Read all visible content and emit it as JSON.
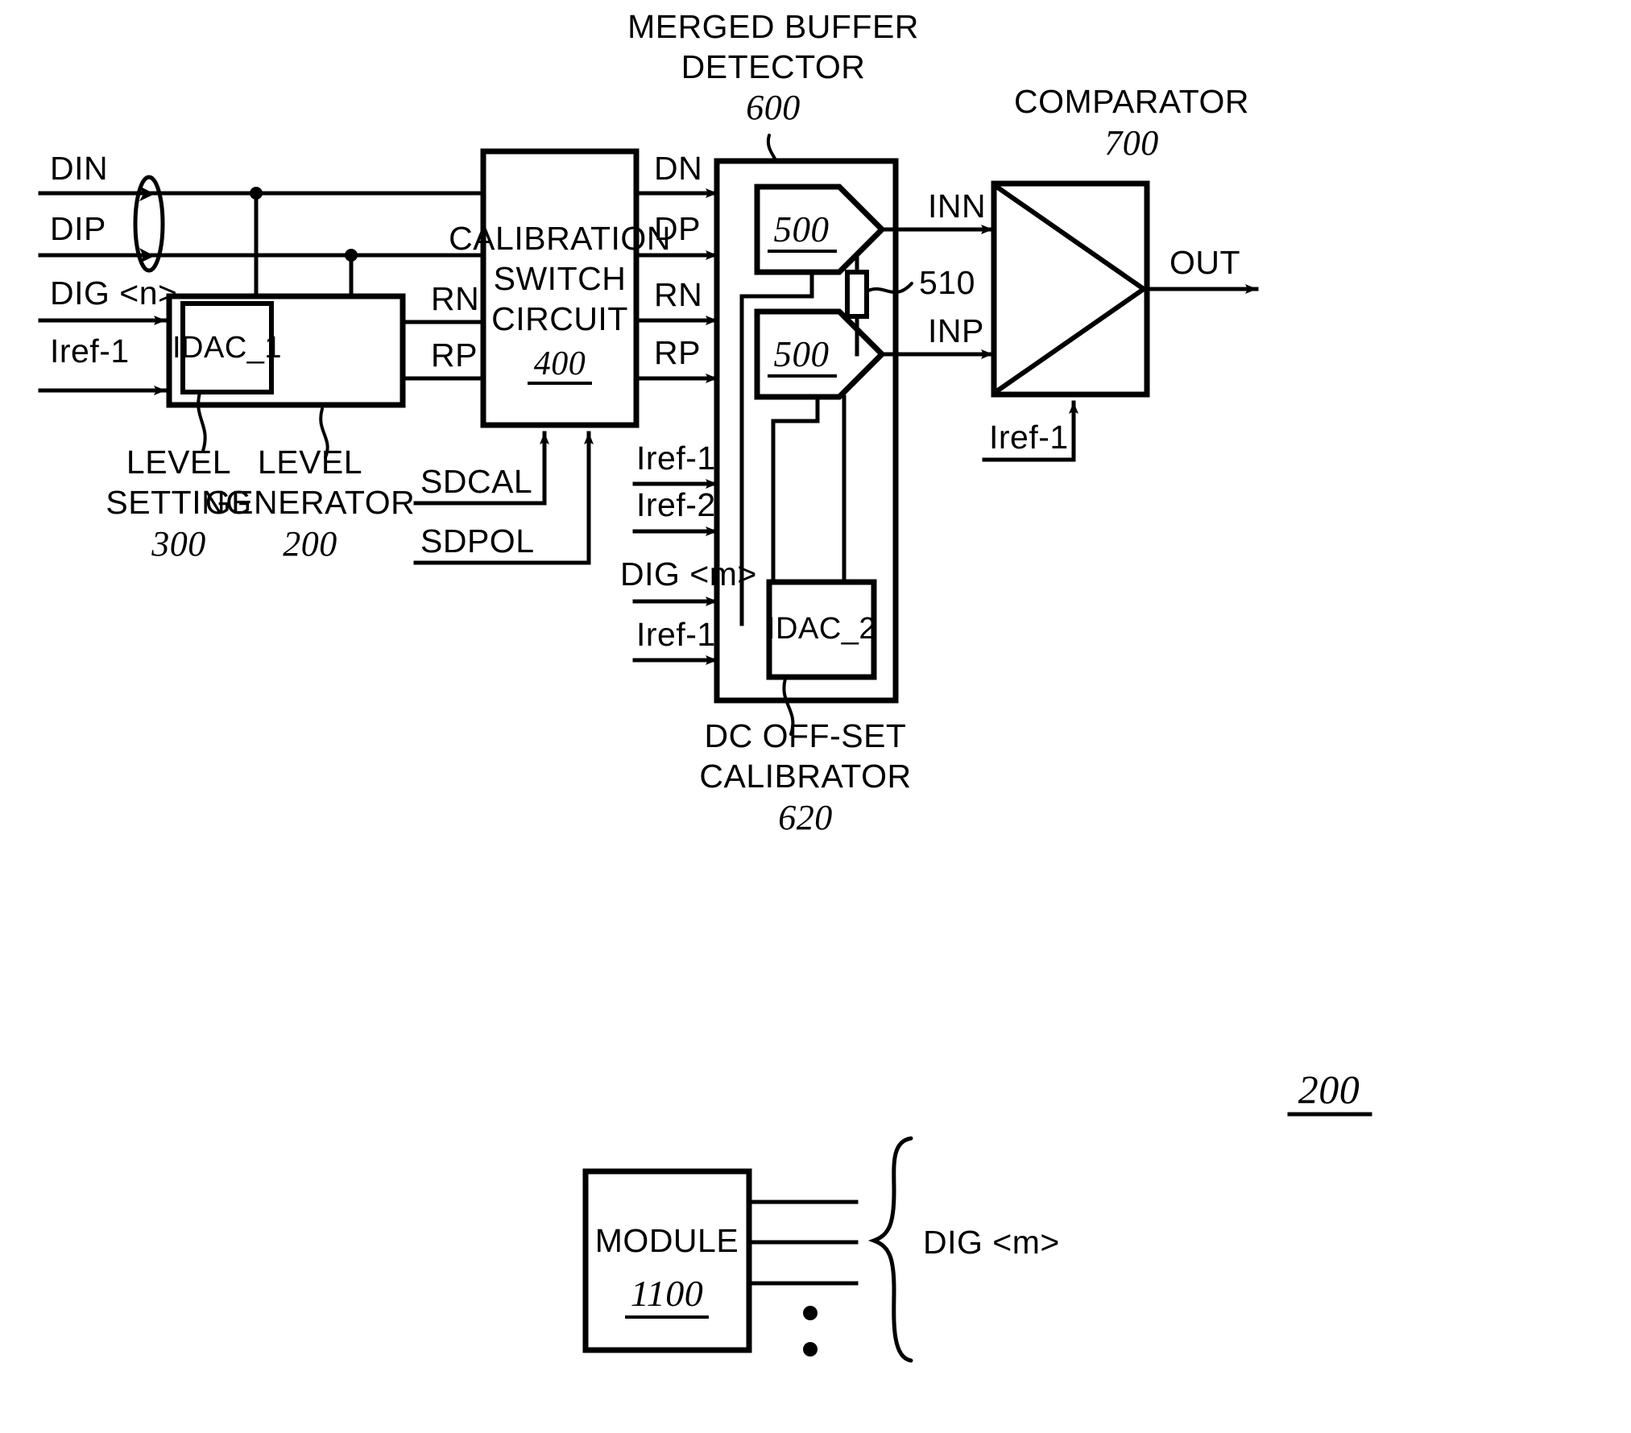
{
  "figure": {
    "figure_number": "200",
    "title_labels": {
      "merged_buffer_detector_l1": "MERGED BUFFER",
      "merged_buffer_detector_l2": "DETECTOR",
      "merged_buffer_detector_num": "600",
      "comparator": "COMPARATOR",
      "comparator_num": "700"
    }
  },
  "inputs": {
    "din": "DIN",
    "dip": "DIP",
    "dig_n": "DIG <n>",
    "iref1_levelsetting": "Iref-1",
    "sdcal": "SDCAL",
    "sdpol": "SDPOL",
    "iref1_detector_a": "Iref-1",
    "iref2_detector": "Iref-2",
    "dig_m_detector": "DIG <m>",
    "iref1_detector_b": "Iref-1",
    "iref1_comparator": "Iref-1"
  },
  "blocks": {
    "idac1": {
      "label": "IDAC_1"
    },
    "level_setting": {
      "line1": "LEVEL",
      "line2": "SETTING",
      "number": "300"
    },
    "level_generator": {
      "line1": "LEVEL",
      "line2": "GENERATOR",
      "number": "200"
    },
    "calibration_switch": {
      "line1": "CALIBRATION",
      "line2": "SWITCH",
      "line3": "CIRCUIT",
      "number": "400"
    },
    "buffer_top": {
      "number": "500"
    },
    "buffer_bottom": {
      "number": "500"
    },
    "resistor": {
      "number": "510"
    },
    "idac2": {
      "label": "IDAC_2"
    },
    "dc_offset_calibrator": {
      "line1": "DC OFF-SET",
      "line2": "CALIBRATOR",
      "number": "620"
    },
    "module": {
      "label": "MODULE",
      "number": "1100"
    }
  },
  "signals": {
    "dn": "DN",
    "dp": "DP",
    "rn_switch_in": "RN",
    "rp_switch_in": "RP",
    "rn_switch_out": "RN",
    "rp_switch_out": "RP",
    "inn": "INN",
    "inp": "INP",
    "out": "OUT",
    "dig_m_bus": "DIG <m>"
  },
  "colors": {
    "line": "#000000",
    "background": "#ffffff"
  }
}
